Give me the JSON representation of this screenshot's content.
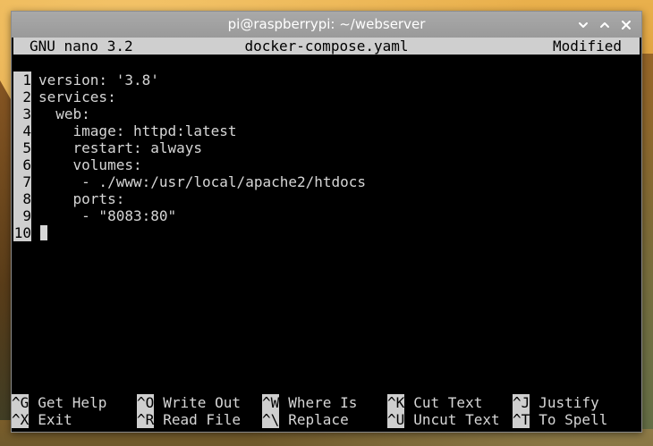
{
  "window": {
    "title": "pi@raspberrypi: ~/webserver",
    "controls": [
      "minimize-icon",
      "maximize-icon",
      "close-icon"
    ]
  },
  "nano": {
    "version_label": "GNU nano 3.2",
    "filename": "docker-compose.yaml",
    "status": "Modified"
  },
  "editor": {
    "lines": [
      {
        "number": "1",
        "text": "version: '3.8'"
      },
      {
        "number": "2",
        "text": "services:"
      },
      {
        "number": "3",
        "text": "  web:"
      },
      {
        "number": "4",
        "text": "    image: httpd:latest"
      },
      {
        "number": "5",
        "text": "    restart: always"
      },
      {
        "number": "6",
        "text": "    volumes:"
      },
      {
        "number": "7",
        "text": "     - ./www:/usr/local/apache2/htdocs"
      },
      {
        "number": "8",
        "text": "    ports:"
      },
      {
        "number": "9",
        "text": "     - \"8083:80\""
      },
      {
        "number": "10",
        "text": ""
      }
    ]
  },
  "shortcuts": {
    "row1": [
      {
        "key": "^G",
        "label": "Get Help"
      },
      {
        "key": "^O",
        "label": "Write Out"
      },
      {
        "key": "^W",
        "label": "Where Is"
      },
      {
        "key": "^K",
        "label": "Cut Text"
      },
      {
        "key": "^J",
        "label": "Justify"
      }
    ],
    "row2": [
      {
        "key": "^X",
        "label": "Exit"
      },
      {
        "key": "^R",
        "label": "Read File"
      },
      {
        "key": "^\\",
        "label": "Replace"
      },
      {
        "key": "^U",
        "label": "Uncut Text"
      },
      {
        "key": "^T",
        "label": "To Spell"
      }
    ]
  },
  "colors": {
    "titlebar": "#9a9a9a",
    "terminal_bg": "#000000",
    "inverse_bg": "#cfcfcf",
    "text": "#d6d6d6"
  }
}
